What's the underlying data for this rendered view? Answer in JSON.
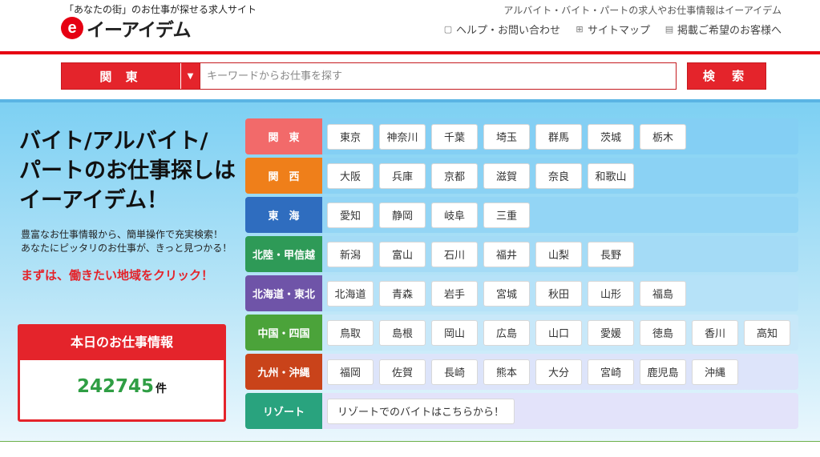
{
  "header": {
    "tagline": "「あなたの街」のお仕事が探せる求人サイト",
    "logo_mark": "e",
    "logo_text": "イーアイデム",
    "description": "アルバイト・バイト・パートの求人やお仕事情報はイーアイデム",
    "links": [
      {
        "label": "ヘルプ・お問い合わせ",
        "icon": "help-icon"
      },
      {
        "label": "サイトマップ",
        "icon": "sitemap-icon"
      },
      {
        "label": "掲載ご希望のお客様へ",
        "icon": "document-icon"
      }
    ]
  },
  "search": {
    "region_label": "関 東",
    "dropdown_arrow": "▼",
    "placeholder": "キーワードからお仕事を探す",
    "button_label": "検 索"
  },
  "hero": {
    "title_lines": [
      "バイト/アルバイト/",
      "パートのお仕事探しは",
      "イーアイデム！"
    ],
    "desc_lines": [
      "豊富なお仕事情報から、簡単操作で充実検索！",
      "あなたにピッタリのお仕事が、きっと見つかる！"
    ],
    "cta": "まずは、働きたい地域をクリック！"
  },
  "today": {
    "heading": "本日のお仕事情報",
    "count": "242745",
    "unit": "件"
  },
  "regions": [
    {
      "name": "関　東",
      "color": "#f26a6a",
      "bg": "#84cff4",
      "prefs": [
        "東京",
        "神奈川",
        "千葉",
        "埼玉",
        "群馬",
        "茨城",
        "栃木"
      ]
    },
    {
      "name": "関　西",
      "color": "#ef7f1a",
      "bg": "#8bd2f4",
      "prefs": [
        "大阪",
        "兵庫",
        "京都",
        "滋賀",
        "奈良",
        "和歌山"
      ]
    },
    {
      "name": "東　海",
      "color": "#2f6dbf",
      "bg": "#93d5f5",
      "prefs": [
        "愛知",
        "静岡",
        "岐阜",
        "三重"
      ]
    },
    {
      "name": "北陸・甲信越",
      "color": "#2e9a57",
      "bg": "#a4dbf6",
      "prefs": [
        "新潟",
        "富山",
        "石川",
        "福井",
        "山梨",
        "長野"
      ]
    },
    {
      "name": "北海道・東北",
      "color": "#6f54a8",
      "bg": "#b6e2f8",
      "prefs": [
        "北海道",
        "青森",
        "岩手",
        "宮城",
        "秋田",
        "山形",
        "福島"
      ]
    },
    {
      "name": "中国・四国",
      "color": "#4ba33a",
      "bg": "#c8e8f9",
      "prefs": [
        "鳥取",
        "島根",
        "岡山",
        "広島",
        "山口",
        "愛媛",
        "徳島",
        "香川",
        "高知"
      ]
    },
    {
      "name": "九州・沖縄",
      "color": "#c9431a",
      "bg": "#dde4fa",
      "prefs": [
        "福岡",
        "佐賀",
        "長崎",
        "熊本",
        "大分",
        "宮崎",
        "鹿児島",
        "沖縄"
      ]
    },
    {
      "name": "リゾート",
      "color": "#29a37e",
      "bg": "#e3e3fa",
      "link": "リゾートでのバイトはこちらから！"
    }
  ]
}
